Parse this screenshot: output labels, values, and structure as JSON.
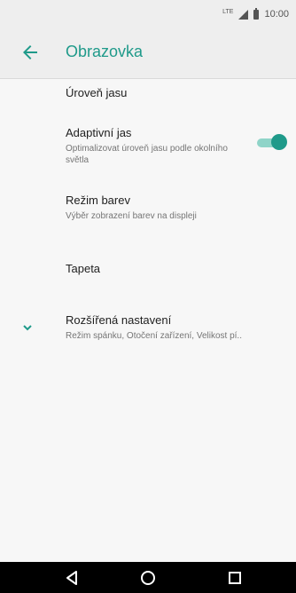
{
  "status_bar": {
    "network": "LTE",
    "time": "10:00"
  },
  "header": {
    "title": "Obrazovka"
  },
  "settings": {
    "brightness_level": {
      "title": "Úroveň jasu"
    },
    "adaptive_brightness": {
      "title": "Adaptivní jas",
      "subtitle": "Optimalizovat úroveň jasu podle okolního světla",
      "enabled": true
    },
    "color_mode": {
      "title": "Režim barev",
      "subtitle": "Výběr zobrazení barev na displeji"
    },
    "wallpaper": {
      "title": "Tapeta"
    },
    "advanced": {
      "title": "Rozšířená nastavení",
      "subtitle": "Režim spánku, Otočení zařízení, Velikost pí.."
    }
  },
  "colors": {
    "accent": "#1f9a8a",
    "toggle_track": "#8fd4c8"
  },
  "icons": {
    "back": "arrow-left-icon",
    "expand": "chevron-down-icon",
    "nav_back": "triangle-back-icon",
    "nav_home": "circle-home-icon",
    "nav_recent": "square-recent-icon"
  }
}
